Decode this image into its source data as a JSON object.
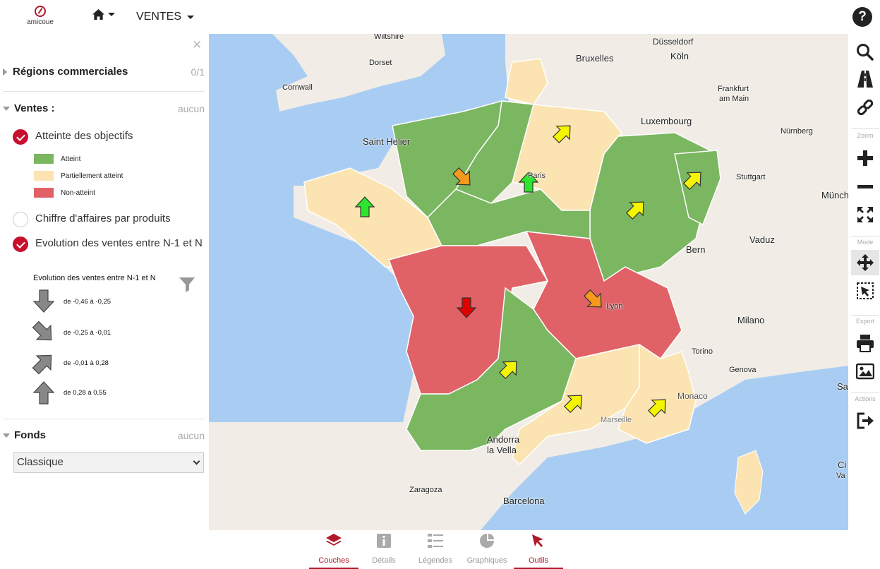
{
  "app": {
    "logo_text": "amicoue",
    "menu_label": "VENTES"
  },
  "panel": {
    "regions": {
      "title": "Régions commerciales",
      "count": "0/1"
    },
    "ventes": {
      "title": "Ventes :",
      "count": "aucun",
      "layers": [
        {
          "label": "Atteinte des objectifs",
          "checked": true
        },
        {
          "label": "Chiffre d'affaires par produits",
          "checked": false
        },
        {
          "label": "Evolution des ventes entre N-1 et N",
          "checked": true
        }
      ],
      "objectives_legend": [
        {
          "label": "Atteint",
          "color": "#7bb661"
        },
        {
          "label": "Partiellement atteint",
          "color": "#fbe4b1"
        },
        {
          "label": "Non-atteint",
          "color": "#e06266"
        }
      ],
      "evolution_legend": {
        "title": "Evolution des ventes entre N-1 et N",
        "classes": [
          {
            "label": "de -0,46 à -0,25",
            "direction": "down"
          },
          {
            "label": "de -0,25 à -0,01",
            "direction": "down-right"
          },
          {
            "label": "de -0,01 à 0,28",
            "direction": "up-right"
          },
          {
            "label": "de 0,28 à 0,55",
            "direction": "up"
          }
        ]
      }
    },
    "fonds": {
      "title": "Fonds",
      "count": "aucun",
      "selected": "Classique"
    }
  },
  "map": {
    "cities": {
      "wiltshire": "Wiltshire",
      "dorset": "Dorset",
      "cornwall": "Cornwall",
      "bruxelles": "Bruxelles",
      "dusseldorf": "Düsseldorf",
      "koln": "Köln",
      "frankfurt_1": "Frankfurt",
      "frankfurt_2": "am Main",
      "luxembourg": "Luxembourg",
      "nurnberg": "Nürnberg",
      "saint_helier": "Saint Helier",
      "stuttgart": "Stuttgart",
      "munchen": "Münch",
      "vaduz": "Vaduz",
      "bern": "Bern",
      "paris": "Paris",
      "lyon": "Lyon",
      "milano": "Milano",
      "torino": "Torino",
      "genova": "Genova",
      "monaco": "Monaco",
      "marseille": "Marseille",
      "andorra_1": "Andorra",
      "andorra_2": "la Vella",
      "zaragoza": "Zaragoza",
      "barcelona": "Barcelona",
      "san": "San",
      "ci": "Ci",
      "va": "Va"
    }
  },
  "toolbar": {
    "groups": [
      "Zoom",
      "Mode",
      "Export",
      "Actions"
    ]
  },
  "bottom_tabs": [
    {
      "label": "Couches",
      "active": true
    },
    {
      "label": "Détails",
      "active": false
    },
    {
      "label": "Légendes",
      "active": false
    },
    {
      "label": "Graphiques",
      "active": false
    },
    {
      "label": "Outils",
      "active": true
    }
  ],
  "colors": {
    "accent": "#b0182a",
    "atteint": "#7bb661",
    "partiel": "#fbe4b1",
    "non_atteint": "#e06266",
    "sea": "#a9cdf2"
  }
}
